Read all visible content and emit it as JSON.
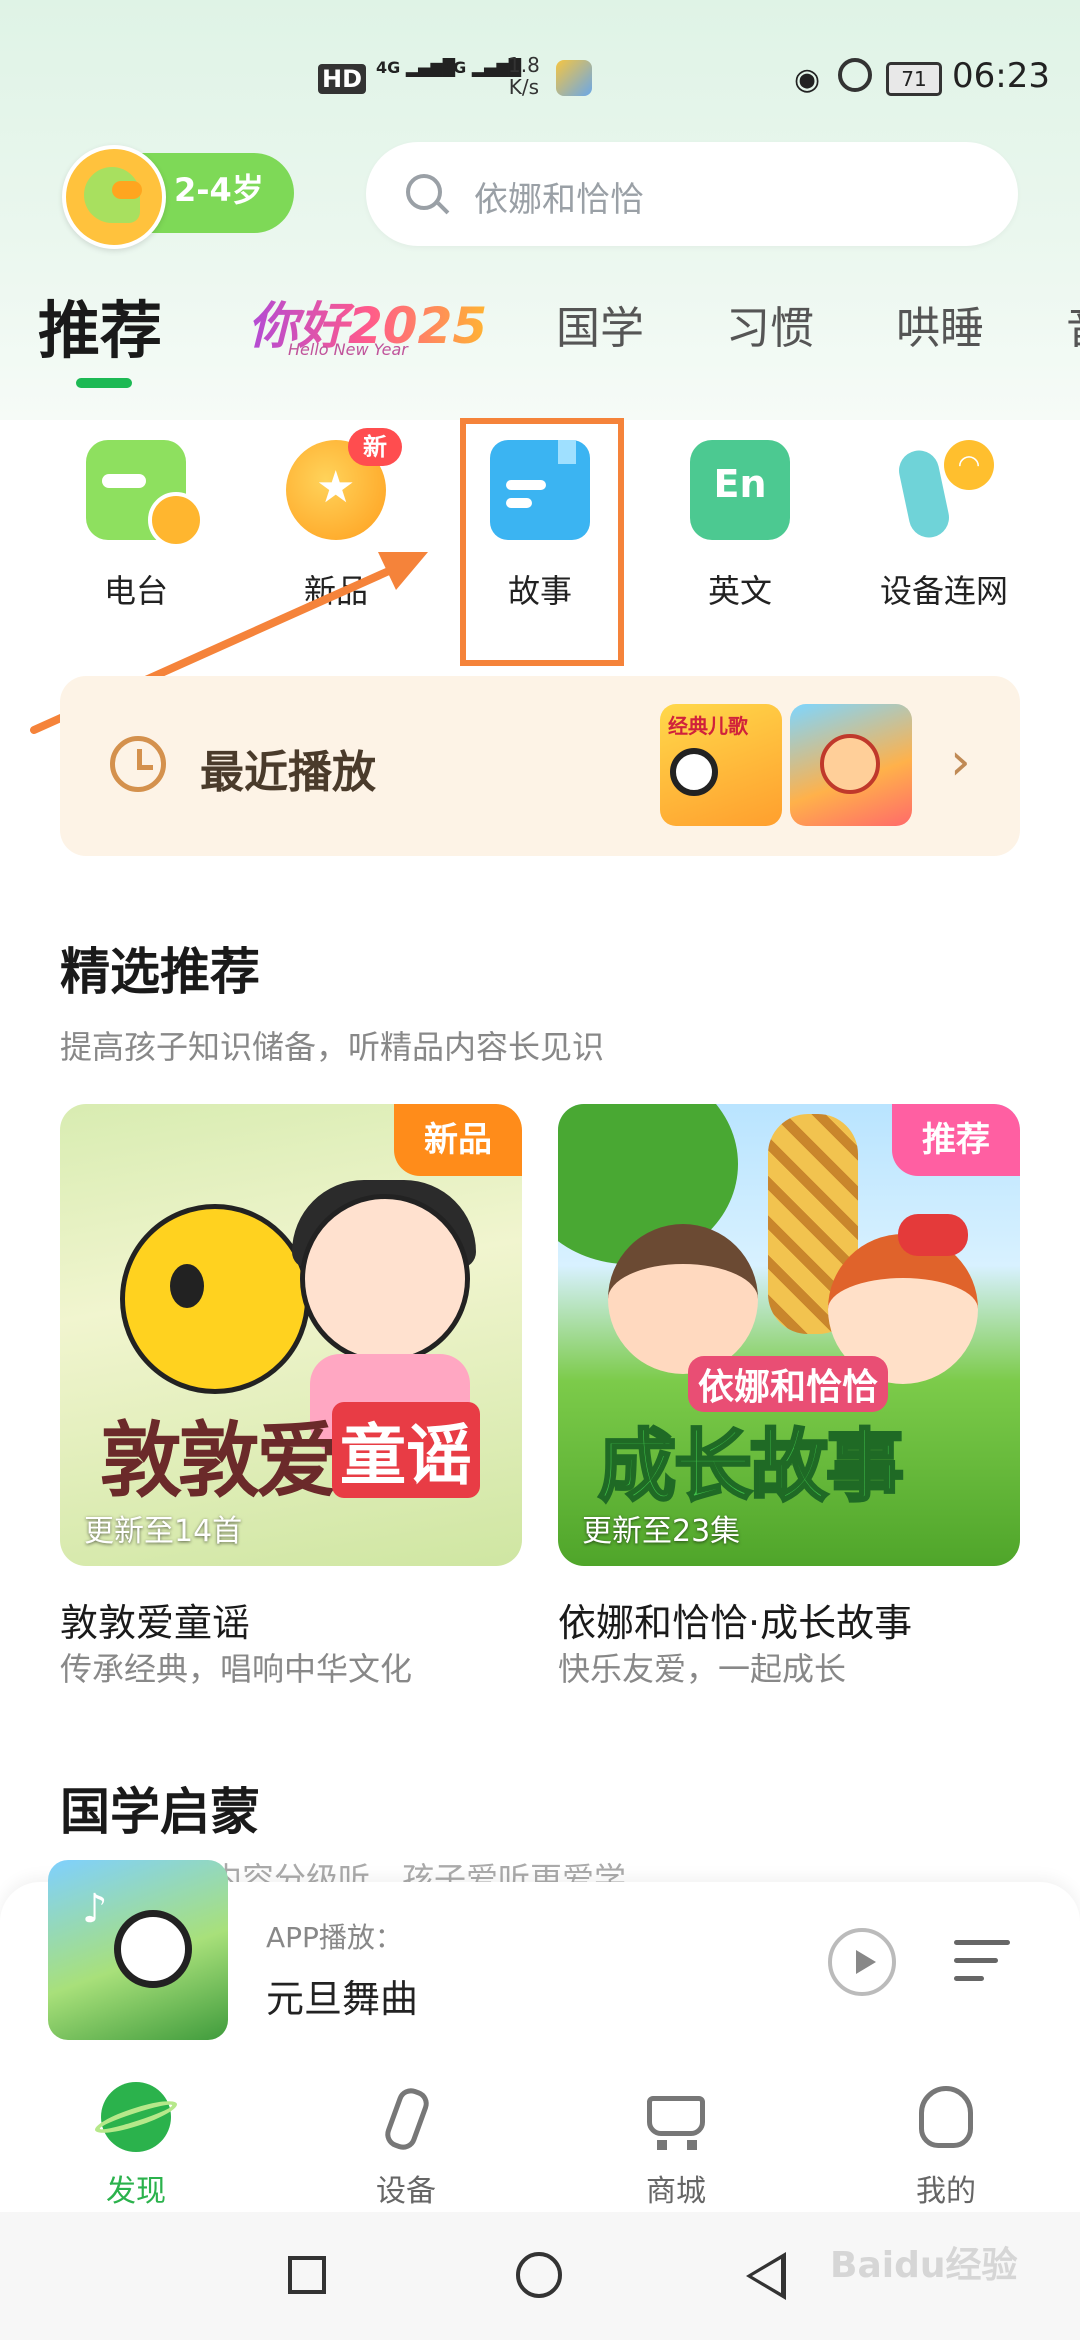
{
  "status_bar": {
    "hd": "HD",
    "signal1": "4G",
    "signal2": "4G",
    "speed_value": "1.8",
    "speed_unit": "K/s",
    "battery": "71",
    "time": "06:23"
  },
  "header": {
    "age_label": "2-4岁",
    "search_placeholder": "依娜和恰恰"
  },
  "tabs": [
    {
      "label": "推荐",
      "active": true
    },
    {
      "label": "你好2025",
      "sub": "Hello New Year",
      "special": true
    },
    {
      "label": "国学"
    },
    {
      "label": "习惯"
    },
    {
      "label": "哄睡"
    },
    {
      "label": "音"
    }
  ],
  "categories": [
    {
      "label": "电台",
      "icon": "radio-icon"
    },
    {
      "label": "新品",
      "icon": "new-product-icon",
      "badge": "新"
    },
    {
      "label": "故事",
      "icon": "story-book-icon"
    },
    {
      "label": "英文",
      "icon": "english-icon",
      "glyph": "En"
    },
    {
      "label": "设备连网",
      "icon": "device-network-icon"
    }
  ],
  "recent": {
    "title": "最近播放",
    "thumb1_text": "经典儿歌"
  },
  "featured": {
    "title": "精选推荐",
    "subtitle": "提高孩子知识储备，听精品内容长见识",
    "cards": [
      {
        "tag": "新品",
        "update": "更新至14首",
        "name": "敦敦爱童谣",
        "desc": "传承经典，唱响中华文化",
        "art_title_a": "敦敦爱",
        "art_title_b": "童谣"
      },
      {
        "tag": "推荐",
        "update": "更新至23集",
        "name": "依娜和恰恰·成长故事",
        "desc": "快乐友爱，一起成长",
        "art_title_a": "依娜和恰恰",
        "art_title_b": "成长故事"
      }
    ]
  },
  "section2": {
    "title": "国学启蒙",
    "subtitle": "内容分级听，孩子爱听更爱学"
  },
  "player": {
    "source": "APP播放：",
    "song": "元旦舞曲"
  },
  "bottom_nav": [
    {
      "label": "发现",
      "active": true
    },
    {
      "label": "设备"
    },
    {
      "label": "商城"
    },
    {
      "label": "我的"
    }
  ],
  "watermark": "Baidu经验",
  "colors": {
    "accent_green": "#2bb24c",
    "highlight_orange": "#f5833a",
    "tag_new": "#ff8c1a",
    "tag_recommend": "#ff5fa2"
  }
}
